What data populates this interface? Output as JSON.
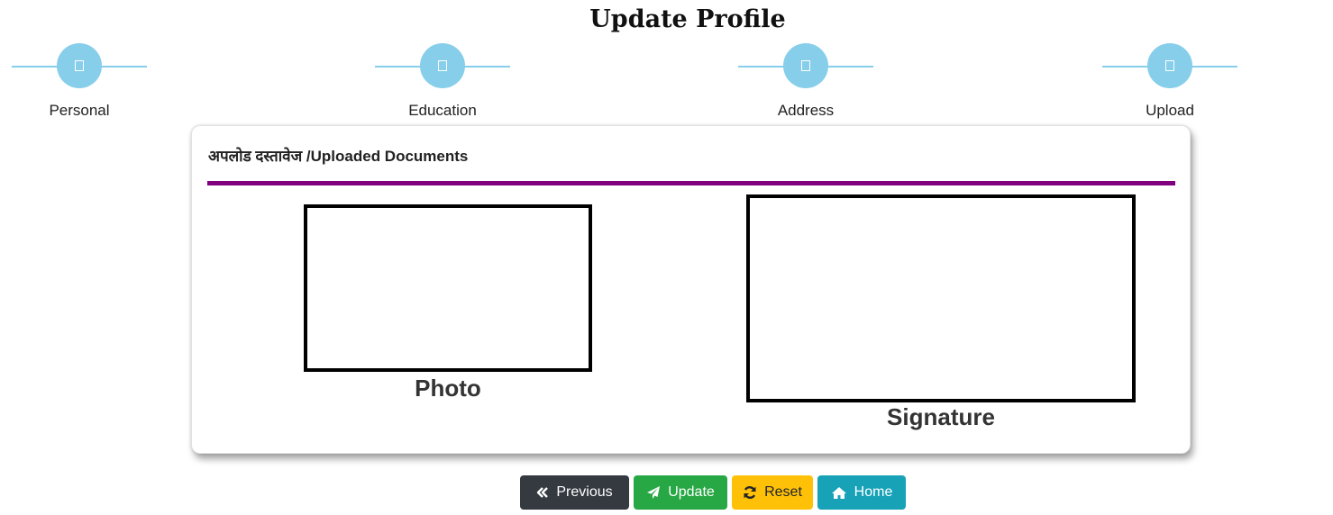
{
  "page": {
    "title": "Update Profile"
  },
  "steps": [
    {
      "label": "Personal",
      "icon": "user-icon"
    },
    {
      "label": "Education",
      "icon": "graduation-icon"
    },
    {
      "label": "Address",
      "icon": "home-icon"
    },
    {
      "label": "Upload",
      "icon": "upload-icon"
    }
  ],
  "card": {
    "heading": "अपलोड दस्तावेज /Uploaded Documents",
    "photo_caption": "Photo",
    "signature_caption": "Signature"
  },
  "buttons": {
    "previous": "Previous",
    "update": "Update",
    "reset": "Reset",
    "home": "Home"
  },
  "colors": {
    "step_accent": "#87ceeb",
    "divider": "#800080",
    "previous_bg": "#343a40",
    "update_bg": "#28a745",
    "reset_bg": "#ffc107",
    "home_bg": "#17a2b8"
  }
}
